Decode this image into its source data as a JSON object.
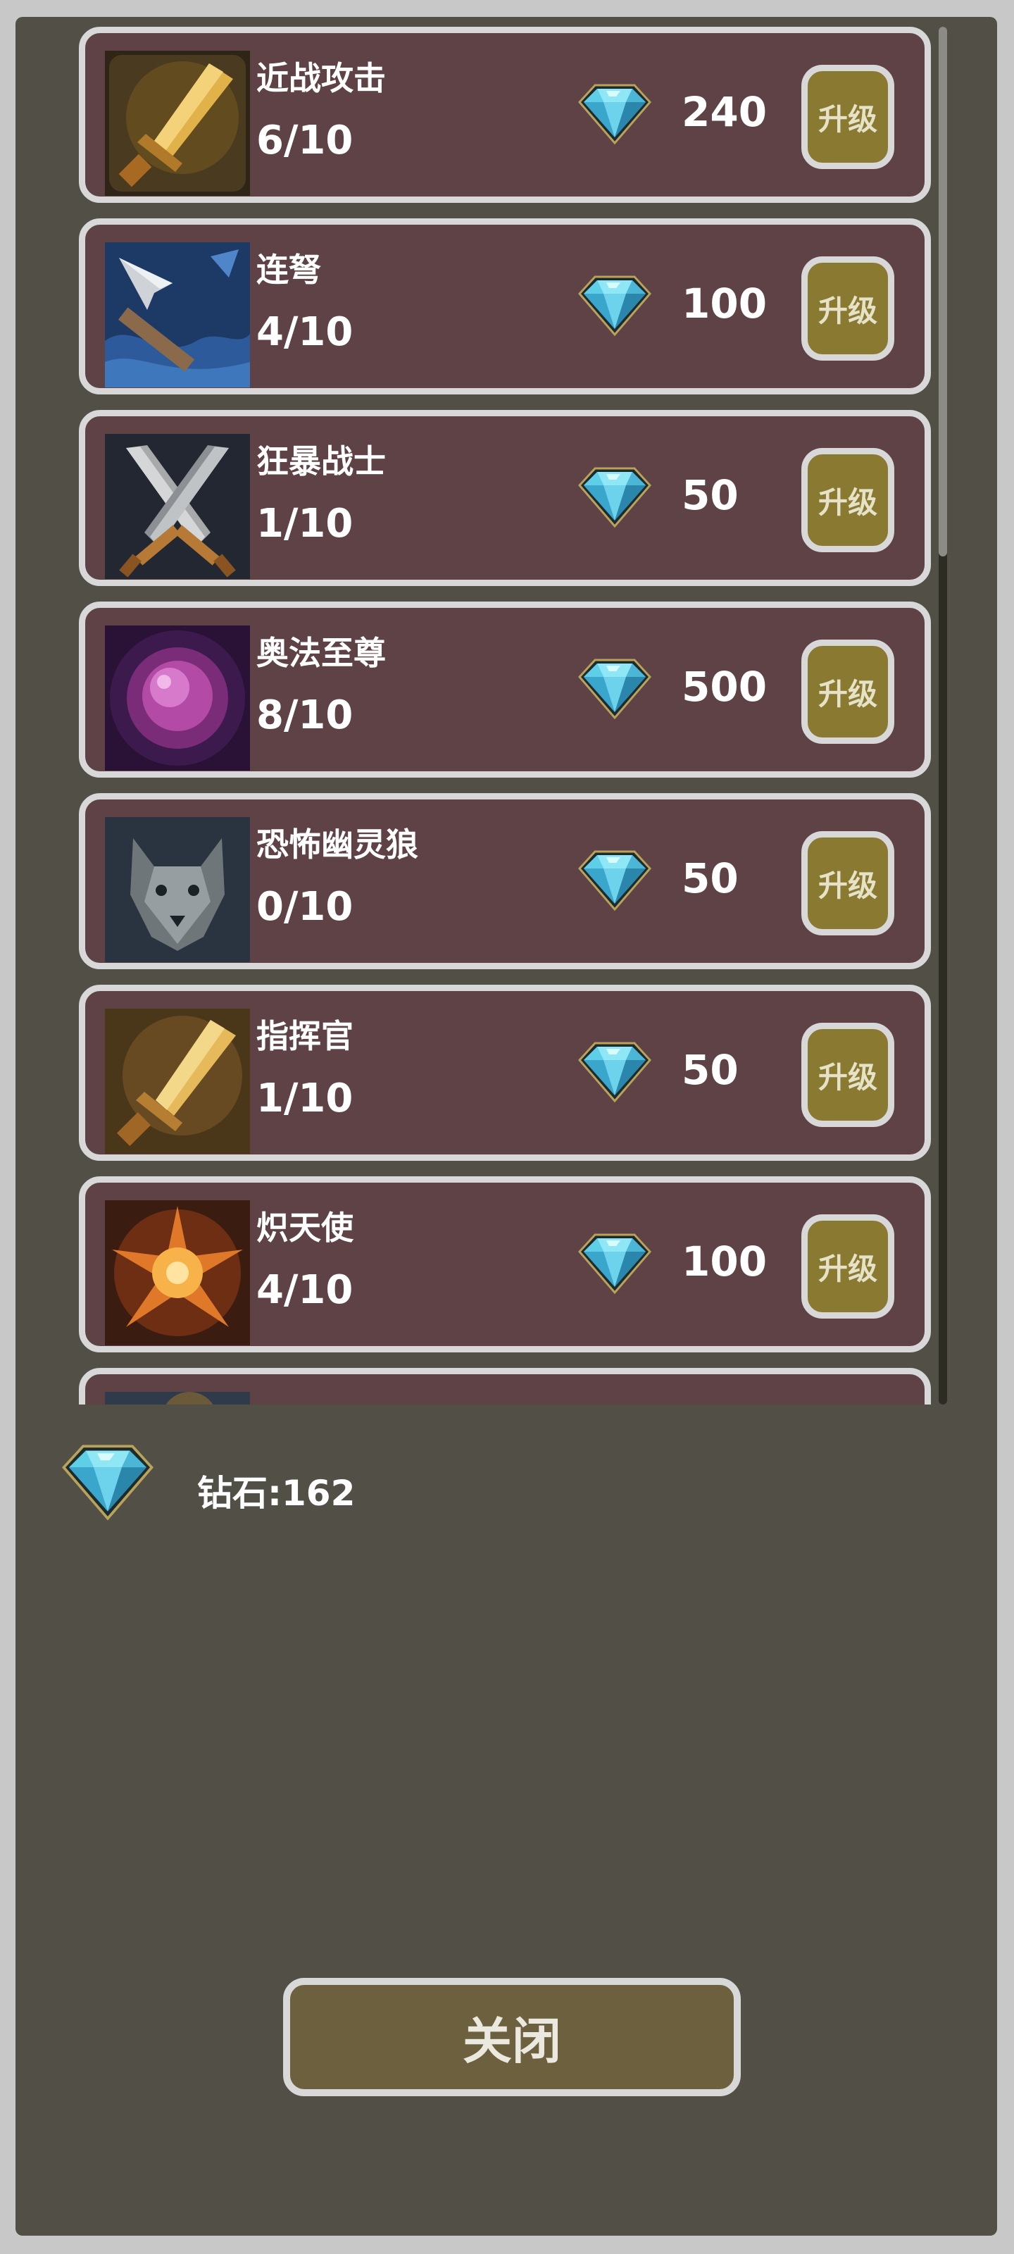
{
  "upgrades": [
    {
      "name": "近战攻击",
      "level": "6/10",
      "cost": "240",
      "button": "升级",
      "icon": "melee-sword-icon"
    },
    {
      "name": "连弩",
      "level": "4/10",
      "cost": "100",
      "button": "升级",
      "icon": "crossbow-arrow-icon"
    },
    {
      "name": "狂暴战士",
      "level": "1/10",
      "cost": "50",
      "button": "升级",
      "icon": "crossed-swords-icon"
    },
    {
      "name": "奥法至尊",
      "level": "8/10",
      "cost": "500",
      "button": "升级",
      "icon": "arcane-orb-icon"
    },
    {
      "name": "恐怖幽灵狼",
      "level": "0/10",
      "cost": "50",
      "button": "升级",
      "icon": "ghost-wolf-icon"
    },
    {
      "name": "指挥官",
      "level": "1/10",
      "cost": "50",
      "button": "升级",
      "icon": "commander-sword-icon"
    },
    {
      "name": "炽天使",
      "level": "4/10",
      "cost": "100",
      "button": "升级",
      "icon": "seraph-burst-icon"
    }
  ],
  "partial_item": {
    "icon": "partial-item-icon"
  },
  "diamonds": {
    "label": "钻石:162",
    "icon": "diamond-icon"
  },
  "close_button": "关闭",
  "colors": {
    "frame": "#c8c8c8",
    "panel": "#525046",
    "card": "#5e4246",
    "card_border": "#d8d8d8",
    "upgrade_button": "#8a7930",
    "close_button": "#6d603f",
    "gem": "#3fb8d8"
  }
}
